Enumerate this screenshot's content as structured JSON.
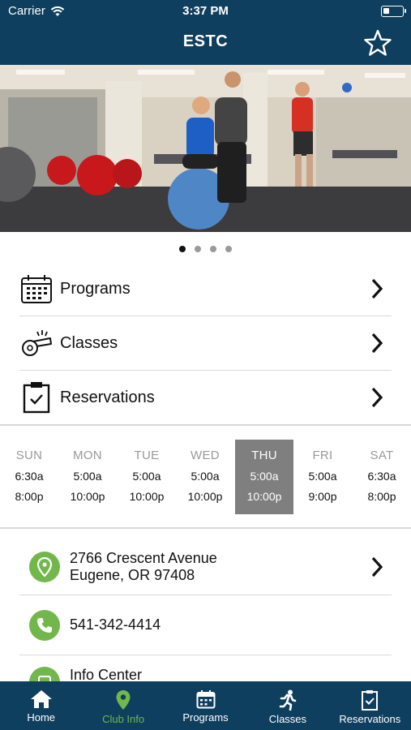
{
  "status_bar": {
    "carrier": "Carrier",
    "time": "3:37 PM"
  },
  "header": {
    "title": "ESTC",
    "favorite_icon": "star-outline-icon"
  },
  "carousel": {
    "page_count": 4,
    "active_index": 0
  },
  "menu": [
    {
      "label": "Programs",
      "icon": "calendar-grid-icon"
    },
    {
      "label": "Classes",
      "icon": "whistle-icon"
    },
    {
      "label": "Reservations",
      "icon": "clipboard-check-icon"
    }
  ],
  "hours": [
    {
      "day": "SUN",
      "open": "6:30a",
      "close": "8:00p",
      "today": false
    },
    {
      "day": "MON",
      "open": "5:00a",
      "close": "10:00p",
      "today": false
    },
    {
      "day": "TUE",
      "open": "5:00a",
      "close": "10:00p",
      "today": false
    },
    {
      "day": "WED",
      "open": "5:00a",
      "close": "10:00p",
      "today": false
    },
    {
      "day": "THU",
      "open": "5:00a",
      "close": "10:00p",
      "today": true
    },
    {
      "day": "FRI",
      "open": "5:00a",
      "close": "9:00p",
      "today": false
    },
    {
      "day": "SAT",
      "open": "6:30a",
      "close": "8:00p",
      "today": false
    }
  ],
  "contact": {
    "address_line1": "2766 Crescent Avenue",
    "address_line2": "Eugene, OR 97408",
    "phone": "541-342-4414",
    "partial_label": "Info Center"
  },
  "tabs": [
    {
      "label": "Home",
      "icon": "house-icon",
      "active": false
    },
    {
      "label": "Club Info",
      "icon": "map-pin-icon",
      "active": true
    },
    {
      "label": "Programs",
      "icon": "calendar-icon",
      "active": false
    },
    {
      "label": "Classes",
      "icon": "running-person-icon",
      "active": false
    },
    {
      "label": "Reservations",
      "icon": "clipboard-icon",
      "active": false
    }
  ],
  "colors": {
    "brand": "#0f3f5e",
    "accent": "#72b74c",
    "today_bg": "#7f7f7f"
  }
}
